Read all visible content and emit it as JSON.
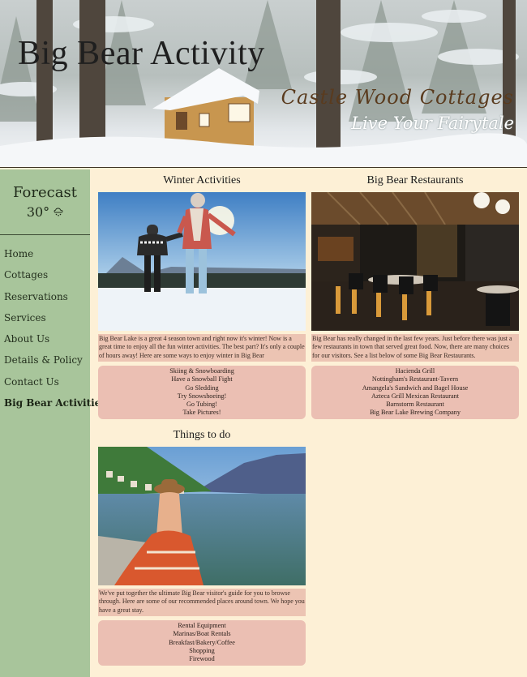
{
  "header": {
    "title": "Big Bear Activity",
    "brand": "Castle Wood Cottages",
    "tagline": "Live Your Fairytale"
  },
  "sidebar": {
    "forecast_label": "Forecast",
    "forecast_temp": "30°",
    "weather_icon": "snow-cloud-icon",
    "items": [
      {
        "label": "Home"
      },
      {
        "label": "Cottages"
      },
      {
        "label": "Reservations"
      },
      {
        "label": "Services"
      },
      {
        "label": "About Us"
      },
      {
        "label": "Details & Policy"
      },
      {
        "label": "Contact Us"
      },
      {
        "label": "Big Bear Activities"
      }
    ]
  },
  "cards": [
    {
      "title": "Winter Activities",
      "description": "Big Bear Lake is a great 4 season town and right now it's winter! Now is a great time to enjoy all the fun winter activities. The best part? It's only a couple of hours away! Here are some ways to enjoy winter in Big Bear",
      "items": [
        "Skiing & Snowboarding",
        "Have a Snowball Fight",
        "Go Sledding",
        "Try Snowshoeing!",
        "Go Tubing!",
        "Take Pictures!"
      ]
    },
    {
      "title": "Big Bear Restaurants",
      "description": "Big Bear has really changed in the last few years. Just before there was just a few restaurants in town that served great food. Now, there are many choices for our visitors. See a list below of some Big Bear Restaurants.",
      "items": [
        "Hacienda Grill",
        "Nottingham's Restaurant-Tavern",
        "Amangela's Sandwich and Bagel House",
        "Azteca Grill Mexican Restaurant",
        "Barnstorm Restaurant",
        "Big Bear Lake Brewing Company"
      ]
    },
    {
      "title": "Things to do",
      "description": "We've put together the ultimate Big Bear visitor's guide for you to browse through. Here are some of our recommended places around town. We hope you have a great stay.",
      "items": [
        "Rental Equipment",
        "Marinas/Boat Rentals",
        "Breakfast/Bakery/Coffee",
        "Shopping",
        "Firewood"
      ]
    }
  ],
  "colors": {
    "page_bg": "#fdf0d6",
    "sidebar_bg": "#a8c59b",
    "card_panel": "#ecc4b3",
    "brand_brown": "#5a3b1e"
  }
}
